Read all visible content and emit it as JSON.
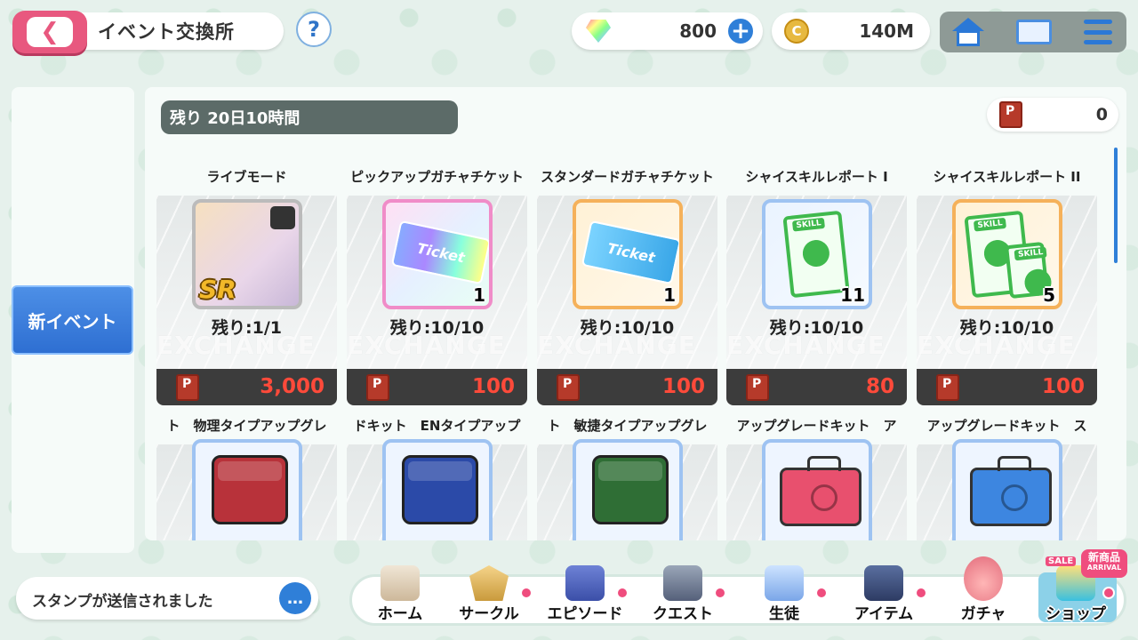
{
  "header": {
    "title": "イベント交換所",
    "help": "?",
    "gems": "800",
    "coins": "140M",
    "coin_glyph": "C"
  },
  "left": {
    "tab": "新イベント"
  },
  "main": {
    "remaining_time": "残り 20日10時間",
    "points": "0",
    "exchange_watermark": "EXCHANGE",
    "items": [
      {
        "name": "ライブモード",
        "qty": "",
        "remain": "残り:1/1",
        "price": "3,000"
      },
      {
        "name": "ピックアップガチャチケット",
        "qty": "1",
        "remain": "残り:10/10",
        "price": "100"
      },
      {
        "name": "スタンダードガチャチケット",
        "qty": "1",
        "remain": "残り:10/10",
        "price": "100"
      },
      {
        "name": "シャイスキルレポート I",
        "qty": "11",
        "remain": "残り:10/10",
        "price": "80"
      },
      {
        "name": "シャイスキルレポート II",
        "qty": "5",
        "remain": "残り:10/10",
        "price": "100"
      }
    ],
    "items_row2": [
      {
        "name": "ト　物理タイプアップグレ"
      },
      {
        "name": "ドキット　ENタイプアップ"
      },
      {
        "name": "ト　敏捷タイプアップグレ"
      },
      {
        "name": "アップグレードキット　ア"
      },
      {
        "name": "アップグレードキット　ス"
      }
    ],
    "ticket_text": "Ticket",
    "sr_badge": "SR"
  },
  "footer": {
    "stamp_message": "スタンプが送信されました",
    "stamp_icon": "…",
    "nav": [
      {
        "label": "ホーム"
      },
      {
        "label": "サークル"
      },
      {
        "label": "エピソード"
      },
      {
        "label": "クエスト"
      },
      {
        "label": "生徒"
      },
      {
        "label": "アイテム"
      },
      {
        "label": "ガチャ"
      },
      {
        "label": "ショップ"
      }
    ],
    "new_badge": "新商品",
    "new_badge_sub": "ARRIVAL",
    "sale": "SALE"
  },
  "colors": {
    "accent": "#2f7fd8",
    "back": "#e8587f",
    "price": "#ff4a3a"
  }
}
